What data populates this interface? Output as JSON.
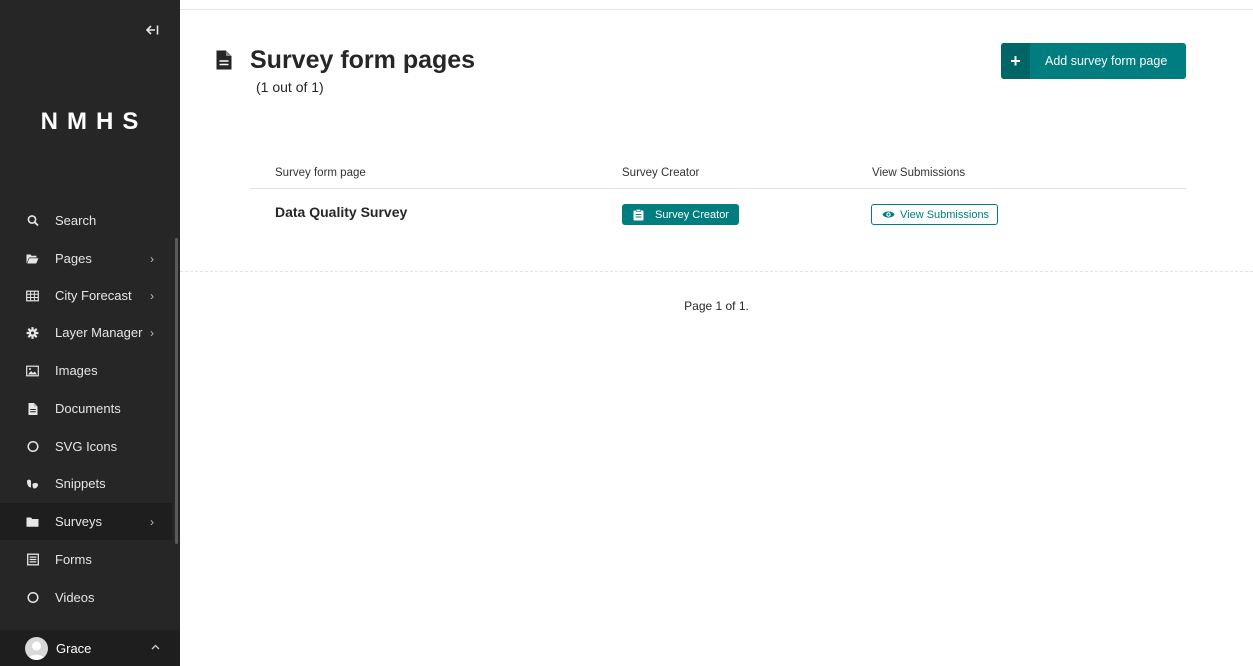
{
  "sidebar": {
    "logo": "NMHS",
    "collapse_icon": "arrow-left-to-line-icon",
    "items": [
      {
        "label": "Search",
        "icon": "search-icon",
        "has_submenu": false
      },
      {
        "label": "Pages",
        "icon": "folder-open-icon",
        "has_submenu": true
      },
      {
        "label": "City Forecast",
        "icon": "table-icon",
        "has_submenu": true
      },
      {
        "label": "Layer Manager",
        "icon": "cog-icon",
        "has_submenu": true
      },
      {
        "label": "Images",
        "icon": "image-icon",
        "has_submenu": false
      },
      {
        "label": "Documents",
        "icon": "document-icon",
        "has_submenu": false
      },
      {
        "label": "SVG Icons",
        "icon": "circle-icon",
        "has_submenu": false
      },
      {
        "label": "Snippets",
        "icon": "snippet-icon",
        "has_submenu": false
      },
      {
        "label": "Surveys",
        "icon": "folder-icon",
        "has_submenu": true,
        "active": true
      },
      {
        "label": "Forms",
        "icon": "form-icon",
        "has_submenu": false
      },
      {
        "label": "Videos",
        "icon": "circle-icon",
        "has_submenu": false
      }
    ],
    "account": {
      "name": "Grace"
    }
  },
  "header": {
    "title": "Survey form pages",
    "count": "(1 out of 1)",
    "add_button": "Add survey form page"
  },
  "table": {
    "columns": [
      "Survey form page",
      "Survey Creator",
      "View Submissions"
    ],
    "rows": [
      {
        "title": "Data Quality Survey",
        "creator_label": "Survey Creator",
        "submissions_label": "View Submissions"
      }
    ]
  },
  "pagination": {
    "text": "Page 1 of 1."
  },
  "colors": {
    "sidebar_bg": "#262626",
    "accent": "#007d7e",
    "accent_dark": "#006566"
  }
}
